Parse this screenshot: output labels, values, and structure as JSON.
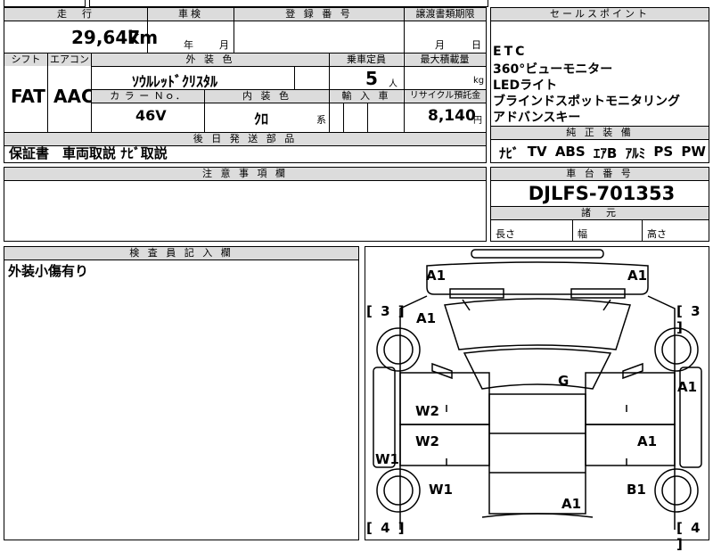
{
  "top_table": {
    "mileage_header": "走　行",
    "mileage_value": "29,647",
    "mileage_unit": "km",
    "shaken_header": "車検",
    "shaken_year": "年",
    "shaken_month": "月",
    "registration_header": "登 録 番 号",
    "transfer_header": "譲渡書類期限",
    "transfer_month": "月",
    "transfer_day": "日",
    "shift_header": "シフト",
    "aircon_header": "エアコン",
    "shift_value": "FAT",
    "aircon_value": "AAC",
    "exterior_color_header": "外 装 色",
    "exterior_color_value": "ｿｳﾙﾚｯﾄﾞｸﾘｽﾀﾙ",
    "capacity_header": "乗車定員",
    "capacity_value": "5",
    "capacity_unit": "人",
    "max_load_header": "最大積載量",
    "max_load_unit": "kg",
    "color_no_header": "カ ラ ー Ｎｏ．",
    "color_no_value": "46V",
    "interior_color_header": "内 装 色",
    "interior_color_value": "ｸﾛ",
    "interior_color_suffix": "系",
    "import_header": "輸 入 車",
    "recycle_header": "リサイクル預託金",
    "recycle_value": "8,140",
    "recycle_unit": "円",
    "later_parts_header": "後 日 発 送 部 品",
    "later_parts_value": "保証書　車両取説 ﾅﾋﾞ取説"
  },
  "sales_points": {
    "header": "セールスポイント",
    "items": [
      "ETC",
      "360°ビューモニター",
      "LEDライト",
      "ブラインドスポットモニタリング",
      "アドバンスキー"
    ]
  },
  "genuine_equipment": {
    "header": "純 正 装 備",
    "items": [
      "ﾅﾋﾞ",
      "TV",
      "ABS",
      "ｴｱB",
      "ｱﾙﾐ",
      "PS",
      "PW"
    ]
  },
  "notes": {
    "header": "注 意 事 項 欄",
    "value": ""
  },
  "chassis": {
    "header": "車 台 番 号",
    "value": "DJLFS-701353",
    "specs_header": "諸　元",
    "length_label": "長さ",
    "width_label": "幅",
    "height_label": "高さ"
  },
  "inspector": {
    "header": "検 査 員 記 入 欄",
    "value": "外装小傷有り"
  },
  "diagram": {
    "marks": {
      "front_left": "A1",
      "front_right": "A1",
      "left_fender": "A1",
      "right_fender": "A1",
      "roof": "G",
      "left_front_door": "W2",
      "left_rear_door": "W2",
      "right_rear_door": "A1",
      "left_sill": "W1",
      "left_quarter": "W1",
      "right_quarter": "B1",
      "rear": "A1"
    },
    "tire_front_left": "3",
    "tire_front_right": "3",
    "tire_rear_left": "4",
    "tire_rear_right": "4"
  }
}
